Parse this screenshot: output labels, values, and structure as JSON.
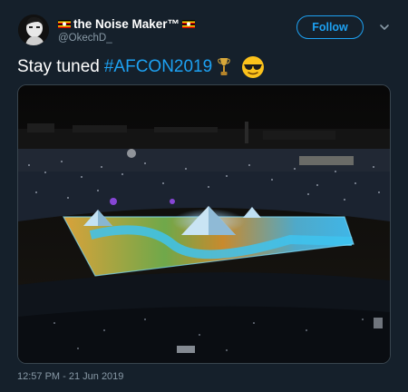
{
  "tweet": {
    "display_name": "the Noise Maker™",
    "handle": "@OkechD_",
    "follow_label": "Follow",
    "text": "Stay tuned",
    "hashtag": "#AFCON2019",
    "emojis": [
      "trophy-icon",
      "smiling-face-with-sunglasses-icon"
    ],
    "timestamp": "12:57 PM - 21 Jun 2019",
    "media": {
      "description_icons": [
        "stadium-photo"
      ]
    }
  },
  "colors": {
    "background": "#15202b",
    "accent": "#1da1f2",
    "secondary_text": "#8899a6",
    "border": "#38444d"
  }
}
